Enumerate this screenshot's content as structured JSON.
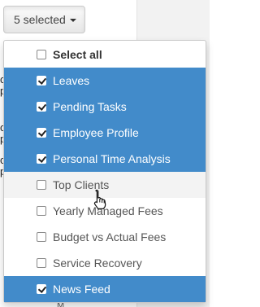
{
  "multiselect": {
    "button_label": "5 selected",
    "options": [
      {
        "label": "Select all",
        "checked": false,
        "state": "select-all"
      },
      {
        "label": "Leaves",
        "checked": true,
        "state": "checked"
      },
      {
        "label": "Pending Tasks",
        "checked": true,
        "state": "checked"
      },
      {
        "label": "Employee Profile",
        "checked": true,
        "state": "checked"
      },
      {
        "label": "Personal Time Analysis",
        "checked": true,
        "state": "checked"
      },
      {
        "label": "Top Clients",
        "checked": false,
        "state": "hover"
      },
      {
        "label": "Yearly Managed Fees",
        "checked": false,
        "state": "normal"
      },
      {
        "label": "Budget vs Actual Fees",
        "checked": false,
        "state": "normal"
      },
      {
        "label": "Service Recovery",
        "checked": false,
        "state": "normal"
      },
      {
        "label": "News Feed",
        "checked": true,
        "state": "checked"
      }
    ]
  },
  "colors": {
    "selected_bg": "#428bca",
    "hover_bg": "#f3f3f3"
  },
  "background": {
    "glyphs": [
      "c",
      "p",
      "c",
      "p",
      "c",
      "p"
    ],
    "footer_text": "M"
  }
}
